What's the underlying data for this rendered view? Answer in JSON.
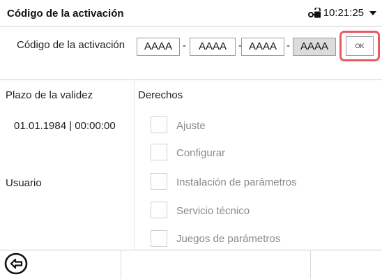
{
  "header": {
    "title": "Código de la activación",
    "time": "10:21:25",
    "lock_icon": "lock-key-icon",
    "menu_icon": "chevron-down-icon"
  },
  "activation": {
    "label": "Código de la activación",
    "segments": [
      "AAAA",
      "AAAA",
      "AAAA",
      "AAAA"
    ],
    "separator": "-",
    "ok_label": "OK",
    "highlight_color": "#e85a62"
  },
  "validity": {
    "label": "Plazo de la validez",
    "value": "01.01.1984 | 00:00:00"
  },
  "user": {
    "label": "Usuario"
  },
  "rights": {
    "label": "Derechos",
    "items": [
      {
        "label": "Ajuste",
        "checked": false
      },
      {
        "label": "Configurar",
        "checked": false
      },
      {
        "label": "Instalación de parámetros",
        "checked": false
      },
      {
        "label": "Servicio técnico",
        "checked": false
      },
      {
        "label": "Juegos de parámetros",
        "checked": false
      }
    ]
  },
  "footer": {
    "back_icon": "back-arrow-icon"
  }
}
